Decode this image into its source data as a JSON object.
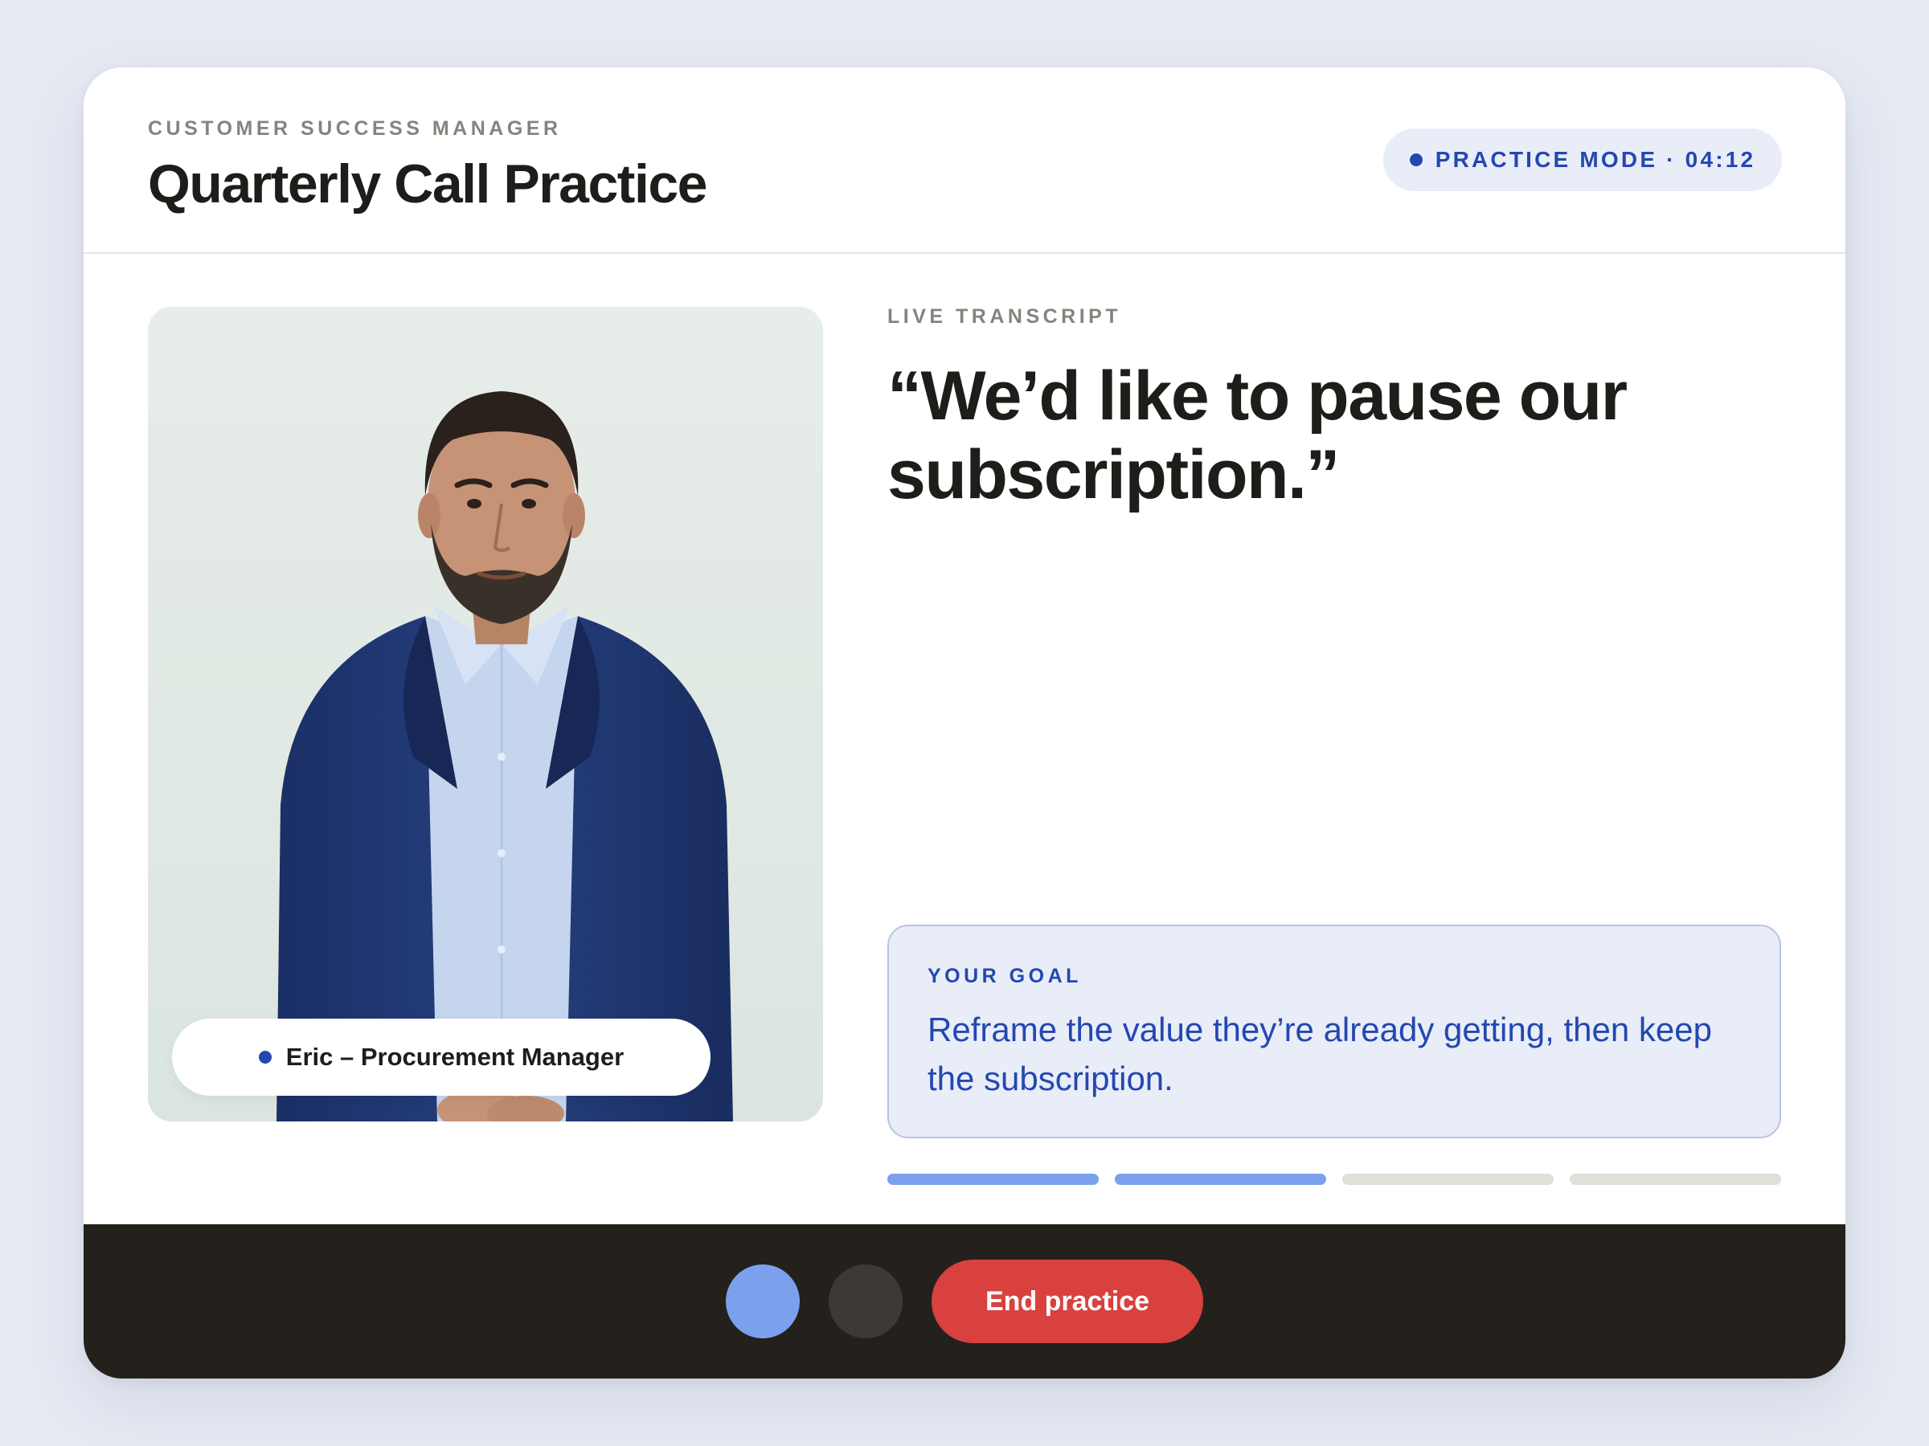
{
  "header": {
    "role": "CUSTOMER SUCCESS MANAGER",
    "title": "Quarterly Call Practice",
    "mode_status": "PRACTICE MODE · 04:12"
  },
  "persona": {
    "name_label": "Eric – Procurement Manager"
  },
  "transcript": {
    "label": "LIVE TRANSCRIPT",
    "quote": "“We’d like to pause our subscription.”"
  },
  "goal": {
    "label": "YOUR GOAL",
    "text": "Reframe the value they’re already getting, then keep the subscription."
  },
  "progress": {
    "completed_steps": 2,
    "total_steps": 4
  },
  "controls": {
    "end_label": "End practice"
  },
  "colors": {
    "accent": "#2447b0",
    "progress_done": "#7ba1ee",
    "danger": "#d8413e",
    "control_bar": "#24211d"
  },
  "icons": [
    "status-dot-icon",
    "microphone-toggle",
    "camera-toggle"
  ]
}
